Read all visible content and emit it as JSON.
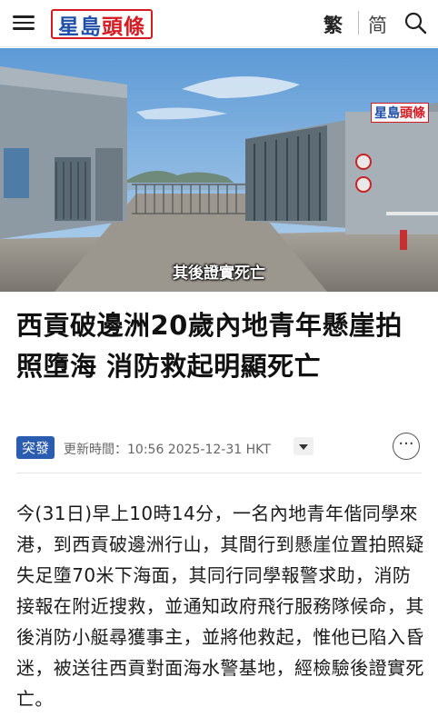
{
  "header": {
    "logo_part1": "星島",
    "logo_part2": "頭條",
    "lang_traditional": "繁",
    "lang_simplified": "简"
  },
  "hero": {
    "caption": "其後證實死亡",
    "watermark_part1": "星島",
    "watermark_part2": "頭條"
  },
  "article": {
    "headline": "西貢破邊洲20歲內地青年懸崖拍照墮海 消防救起明顯死亡",
    "tag": "突發",
    "updated": "更新時間：10:56 2025-12-31 HKT",
    "more_label": "···",
    "body": "今(31日)早上10時14分，一名內地青年偕同學來港，到西貢破邊洲行山，其間行到懸崖位置拍照疑失足墮70米下海面，其同行同學報警求助，消防接報在附近搜救，並通知政府飛行服務隊候命，其後消防小艇尋獲事主，並將他救起，惟他已陷入昏迷，被送往西貢對面海水警基地，經檢驗後證實死亡。"
  },
  "colors": {
    "brand_blue": "#1f4fa8",
    "brand_red": "#d51a21",
    "tag_blue": "#2a5db0"
  },
  "icons": [
    "menu-icon",
    "search-icon",
    "chevron-down-icon",
    "more-icon"
  ]
}
